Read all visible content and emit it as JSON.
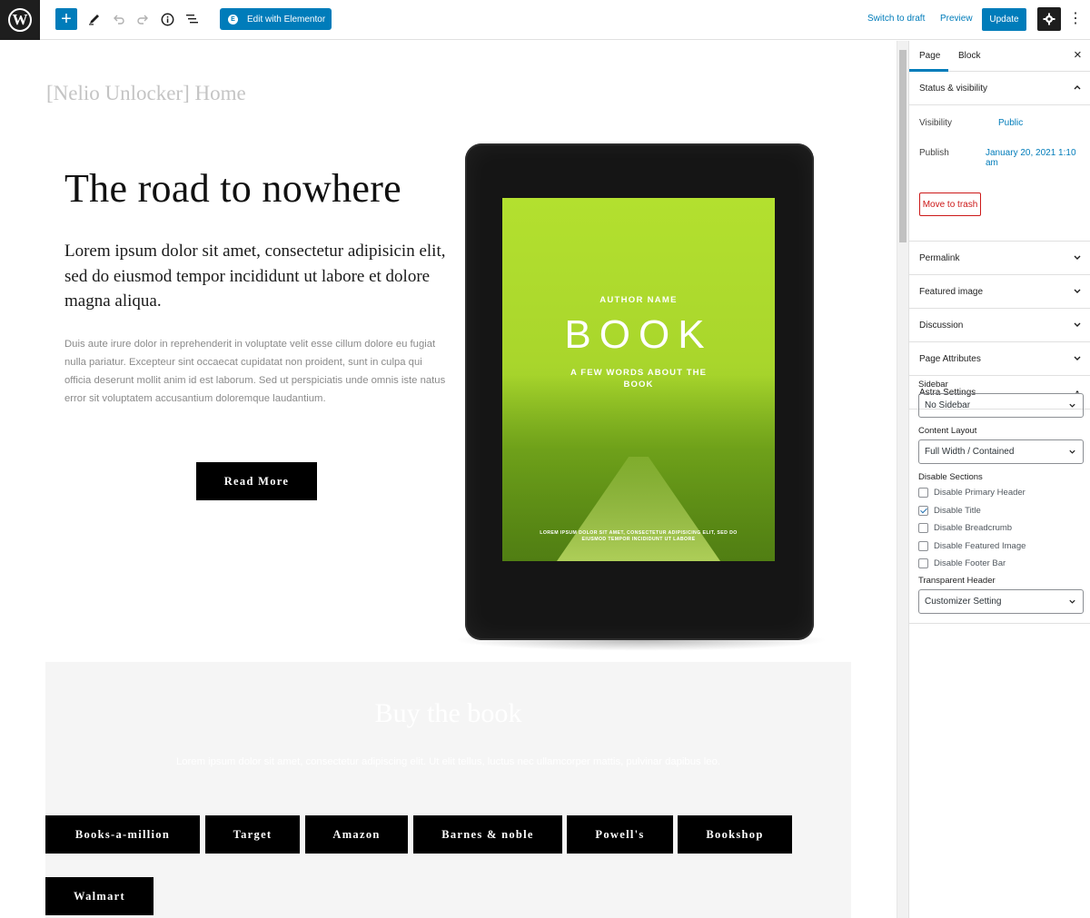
{
  "toolbar": {
    "edit_with_elementor_label": "Edit with Elementor",
    "switch_to_draft_label": "Switch to draft",
    "preview_label": "Preview",
    "update_label": "Update",
    "icons": [
      "wordpress-logo-icon",
      "add-block-icon",
      "pen-tool-icon",
      "undo-icon",
      "redo-icon",
      "info-icon",
      "list-view-icon",
      "elementor-icon",
      "settings-gear-icon",
      "more-options-icon"
    ],
    "accent_color": "#007cba"
  },
  "editor": {
    "page_title": "[Nelio Unlocker] Home",
    "hero": {
      "heading": "The road to nowhere",
      "lead": "Lorem ipsum dolor sit amet, consectetur adipisicin elit, sed do eiusmod tempor incididunt ut labore et dolore magna aliqua.",
      "body": "Duis aute irure dolor in reprehenderit in voluptate velit esse cillum dolore eu fugiat nulla pariatur. Excepteur sint occaecat cupidatat non proident, sunt in culpa qui officia deserunt mollit anim id est laborum. Sed ut perspiciatis unde omnis iste natus error sit voluptatem accusantium doloremque laudantium.",
      "button_label": "Read More"
    },
    "book_cover": {
      "author": "AUTHOR NAME",
      "title": "BOOK",
      "tagline": "A FEW WORDS ABOUT THE BOOK",
      "fineprint": "LOREM IPSUM DOLOR SIT AMET, CONSECTETUR ADIPISICING ELIT, SED DO EIUSMOD TEMPOR INCIDIDUNT UT LABORE",
      "cover_color": "#b3e02f"
    },
    "buy_section": {
      "heading": "Buy the book",
      "description": "Lorem ipsum dolor sit amet, consectetur adipiscing elit. Ut elit tellus, luctus nec ullamcorper mattis, pulvinar dapibus leo.",
      "stores": [
        "Books-a-million",
        "Target",
        "Amazon",
        "Barnes & noble",
        "Powell's",
        "Bookshop",
        "Walmart"
      ]
    }
  },
  "sidebar": {
    "tabs": [
      "Page",
      "Block"
    ],
    "active_tab": "Page",
    "status_visibility": {
      "title": "Status & visibility",
      "visibility_label": "Visibility",
      "visibility_value": "Public",
      "publish_label": "Publish",
      "publish_value": "January 20, 2021 1:10 am",
      "trash_label": "Move to trash"
    },
    "panels": [
      "Permalink",
      "Featured image",
      "Discussion",
      "Page Attributes",
      "Astra Settings"
    ],
    "astra": {
      "sidebar_label": "Sidebar",
      "sidebar_value": "No Sidebar",
      "content_layout_label": "Content Layout",
      "content_layout_value": "Full Width / Contained",
      "disable_sections_label": "Disable Sections",
      "checkboxes": [
        {
          "label": "Disable Primary Header",
          "checked": false
        },
        {
          "label": "Disable Title",
          "checked": true
        },
        {
          "label": "Disable Breadcrumb",
          "checked": false
        },
        {
          "label": "Disable Featured Image",
          "checked": false
        },
        {
          "label": "Disable Footer Bar",
          "checked": false
        }
      ],
      "transparent_header_label": "Transparent Header",
      "transparent_header_value": "Customizer Setting"
    }
  }
}
